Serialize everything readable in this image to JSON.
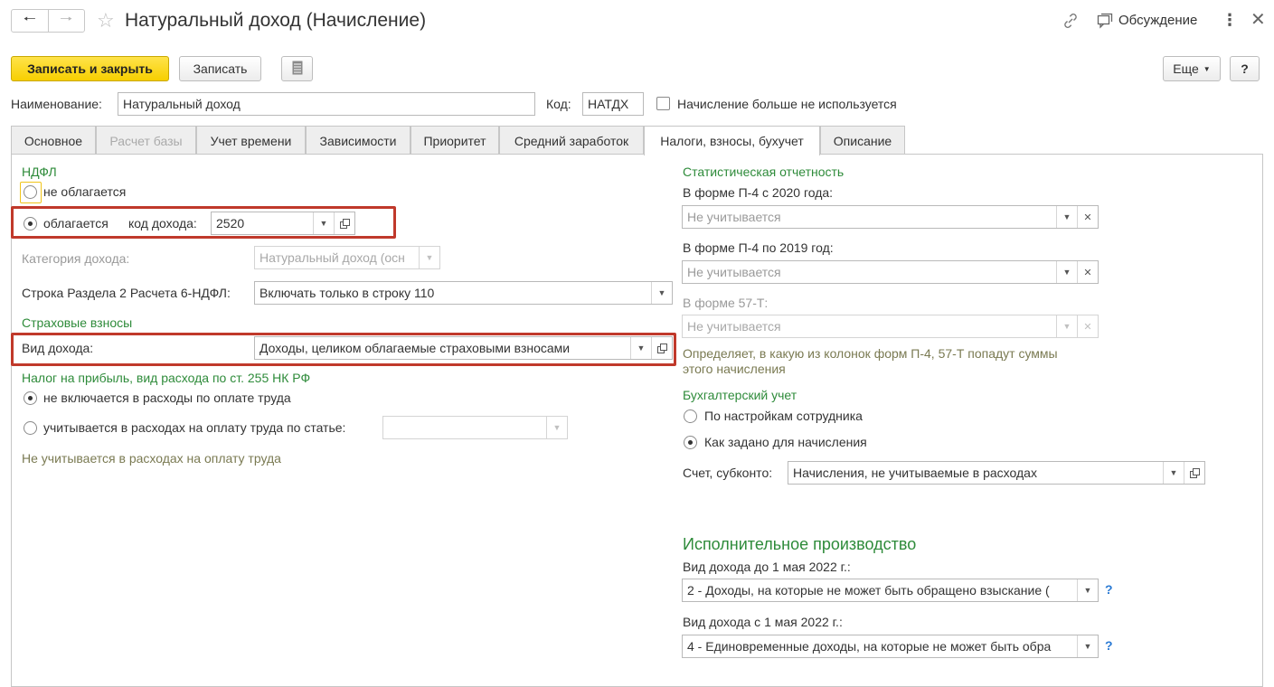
{
  "window": {
    "title": "Натуральный доход (Начисление)",
    "discussion_label": "Обсуждение"
  },
  "toolbar": {
    "save_close_label": "Записать и закрыть",
    "save_label": "Записать",
    "more_label": "Еще",
    "help_label": "?"
  },
  "header": {
    "name_label": "Наименование:",
    "name_value": "Натуральный доход",
    "code_label": "Код:",
    "code_value": "НАТДХ",
    "unused_label": "Начисление больше не используется"
  },
  "tabs": [
    {
      "label": "Основное"
    },
    {
      "label": "Расчет базы"
    },
    {
      "label": "Учет времени"
    },
    {
      "label": "Зависимости"
    },
    {
      "label": "Приоритет"
    },
    {
      "label": "Средний заработок"
    },
    {
      "label": "Налоги, взносы, бухучет"
    },
    {
      "label": "Описание"
    }
  ],
  "ndfl": {
    "section_title": "НДФЛ",
    "not_taxed_label": "не облагается",
    "taxed_label": "облагается",
    "income_code_label": "код дохода:",
    "income_code_value": "2520",
    "category_label": "Категория дохода:",
    "category_value": "Натуральный доход (осн",
    "row_6ndfl_label": "Строка Раздела 2 Расчета 6-НДФЛ:",
    "row_6ndfl_value": "Включать только в строку 110"
  },
  "insurance": {
    "section_title": "Страховые взносы",
    "income_type_label": "Вид дохода:",
    "income_type_value": "Доходы, целиком облагаемые страховыми взносами"
  },
  "profit_tax": {
    "section_title": "Налог на прибыль, вид расхода по ст. 255 НК РФ",
    "not_included_label": "не включается в расходы по оплате труда",
    "included_label": "учитывается в расходах на оплату труда по статье:",
    "article_value": "",
    "note": "Не учитывается в расходах на оплату труда"
  },
  "statistics": {
    "section_title": "Статистическая отчетность",
    "p4_2020_label": "В форме П-4 с 2020 года:",
    "p4_2020_value": "Не учитывается",
    "p4_2019_label": "В форме П-4 по 2019 год:",
    "p4_2019_value": "Не учитывается",
    "f57t_label": "В форме 57-Т:",
    "f57t_value": "Не учитывается",
    "note_line1": "Определяет, в какую из колонок форм П-4, 57-Т попадут суммы",
    "note_line2": "этого начисления"
  },
  "accounting": {
    "section_title": "Бухгалтерский учет",
    "by_employee_label": "По настройкам сотрудника",
    "as_set_label": "Как задано для начисления",
    "account_label": "Счет, субконто:",
    "account_value": "Начисления, не учитываемые в расходах"
  },
  "enforcement": {
    "section_title": "Исполнительное производство",
    "before_label": "Вид дохода до 1 мая 2022 г.:",
    "before_value": "2 - Доходы, на которые не может быть обращено взыскание (",
    "after_label": "Вид дохода с 1 мая 2022 г.:",
    "after_value": "4 - Единовременные доходы, на которые не может быть обра",
    "help_mark": "?"
  },
  "colors": {
    "primary_button": "#f7cf00",
    "section_title": "#2e8b3a",
    "highlight_frame": "#c0392b"
  },
  "icons": [
    "back-arrow-icon",
    "forward-arrow-icon",
    "star-icon",
    "link-icon",
    "discussion-icon",
    "kebab-menu-icon",
    "close-icon",
    "report-icon",
    "dropdown-icon",
    "open-icon",
    "clear-icon"
  ]
}
